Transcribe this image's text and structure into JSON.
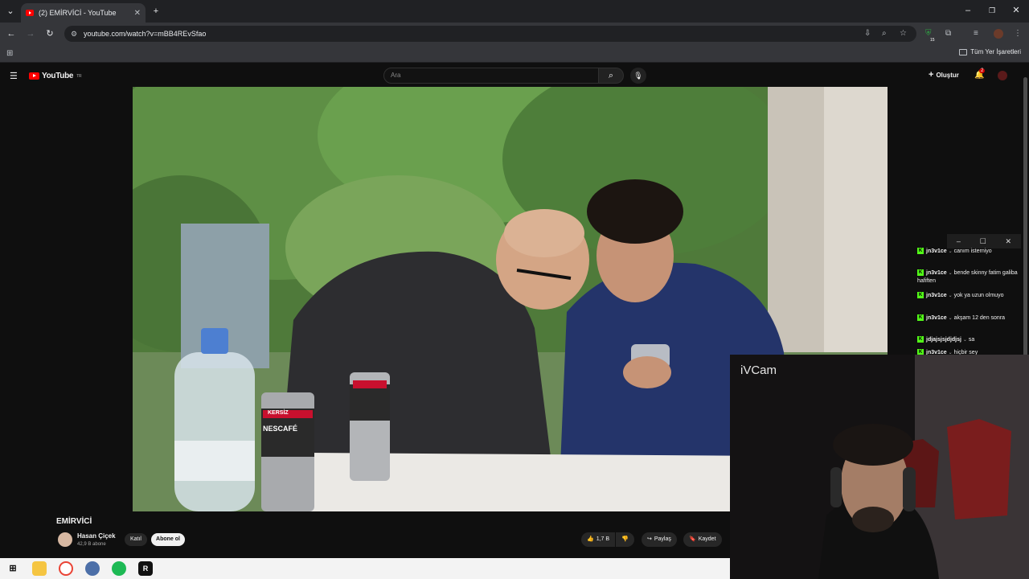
{
  "browser": {
    "tab_title": "(2) EMİRVİCİ - YouTube",
    "tab_close": "✕",
    "new_tab": "+",
    "url": "youtube.com/watch?v=mBB4REvSfao",
    "bookmarks_folder": "Tüm Yer İşaretleri",
    "extension_badge": "15"
  },
  "youtube": {
    "logo_text": "YouTube",
    "country_code": "TR",
    "search_placeholder": "Ara",
    "create_label": "Oluştur",
    "notification_count": "2"
  },
  "video": {
    "title": "EMİRVİCİ",
    "channel_name": "Hasan Çiçek",
    "subscribers": "42,9 B abone",
    "join_label": "Katıl",
    "subscribe_label": "Abone ol",
    "like_count": "1,7 B",
    "share_label": "Paylaş",
    "save_label": "Kaydet",
    "can_brand": "NESCAFÉ",
    "can_brand_top": "KERSİZ"
  },
  "chat": {
    "messages": [
      {
        "user": "jn3v1ce",
        "text": "canım isterniyo"
      },
      {
        "user": "jn3v1ce",
        "text": "bende skinny fatim galiba hafiften"
      },
      {
        "user": "jn3v1ce",
        "text": "yok ya uzun olmuyo"
      },
      {
        "user": "jn3v1ce",
        "text": "akşam 12 den sonra"
      },
      {
        "user": "jdjajsjsjdjdjsj",
        "text": "sa"
      },
      {
        "user": "jn3v1ce",
        "text": "hiçbir sey"
      }
    ]
  },
  "ivcam": {
    "label": "iVCam"
  },
  "colors": {
    "youtube_red": "#ff0000",
    "kick_green": "#53fc18",
    "page_bg": "#0f0f0f"
  }
}
